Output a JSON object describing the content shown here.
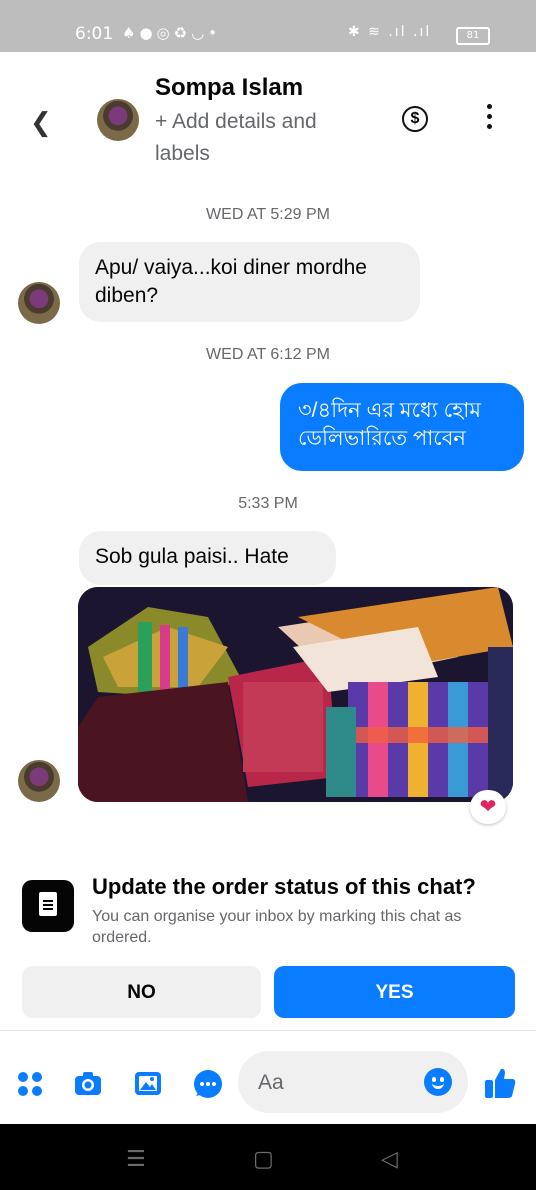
{
  "status_bar": {
    "time": "6:01",
    "battery": "81"
  },
  "header": {
    "contact_name": "Sompa Islam",
    "subtitle": "+ Add details and labels"
  },
  "messages": [
    {
      "type": "timestamp",
      "text": "WED AT 5:29 PM"
    },
    {
      "type": "incoming",
      "text": "Apu/ vaiya...koi diner mordhe diben?"
    },
    {
      "type": "timestamp",
      "text": "WED AT 6:12 PM"
    },
    {
      "type": "outgoing",
      "text": "৩/৪দিন এর মধ্যে হোম ডেলিভারিতে পাবেন"
    },
    {
      "type": "timestamp",
      "text": "5:33 PM"
    },
    {
      "type": "incoming",
      "text": "Sob gula paisi..  Hate"
    },
    {
      "type": "incoming_photo",
      "reaction": "heart"
    }
  ],
  "order_prompt": {
    "title": "Update the order status of this chat?",
    "description": "You can organise your inbox by marking this chat as ordered.",
    "no_label": "NO",
    "yes_label": "YES"
  },
  "composer": {
    "placeholder": "Aa",
    "icons": [
      "apps-icon",
      "camera-icon",
      "gallery-icon",
      "sticker-icon",
      "emoji-icon",
      "like-icon"
    ]
  },
  "colors": {
    "accent": "#0a7cff",
    "incoming_bubble": "#f0f0f0",
    "secondary_text": "#65676b"
  }
}
